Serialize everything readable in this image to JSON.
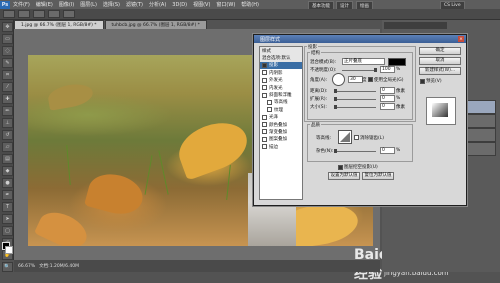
{
  "menubar": {
    "items": [
      "文件(F)",
      "编辑(E)",
      "图像(I)",
      "图层(L)",
      "选择(S)",
      "滤镜(T)",
      "分析(A)",
      "3D(D)",
      "视图(V)",
      "窗口(W)",
      "帮助(H)"
    ],
    "workspace_buttons": [
      "基本功能",
      "设计",
      "绘画",
      "CS Live"
    ]
  },
  "doc_tabs": [
    "1.jpg @ 66.7% (图层 1, RGB/8#) *",
    "tuhbcb.jpg @ 66.7% (图层 1, RGB/8#) *"
  ],
  "statusbar": {
    "zoom": "66.67%",
    "doc_info": "文档:1.20M/6.40M"
  },
  "dialog": {
    "title": "图层样式",
    "styles": [
      {
        "label": "样式",
        "type": "header"
      },
      {
        "label": "混合选项:默认",
        "type": "header"
      },
      {
        "label": "投影",
        "checked": true,
        "selected": true
      },
      {
        "label": "内阴影",
        "checked": false
      },
      {
        "label": "外发光",
        "checked": false
      },
      {
        "label": "内发光",
        "checked": false
      },
      {
        "label": "斜面和浮雕",
        "checked": false
      },
      {
        "label": "等高线",
        "checked": false,
        "sub": true
      },
      {
        "label": "纹理",
        "checked": false,
        "sub": true
      },
      {
        "label": "光泽",
        "checked": false
      },
      {
        "label": "颜色叠加",
        "checked": false
      },
      {
        "label": "渐变叠加",
        "checked": false
      },
      {
        "label": "图案叠加",
        "checked": false
      },
      {
        "label": "描边",
        "checked": false
      }
    ],
    "section_title": "投影",
    "structure_title": "结构",
    "blend_mode_label": "混合模式(B):",
    "blend_mode_value": "正片叠底",
    "opacity_label": "不透明度(O):",
    "opacity_value": "100",
    "opacity_unit": "%",
    "angle_label": "角度(A):",
    "angle_value": "30",
    "angle_unit": "度",
    "global_light_label": "使用全局光(G)",
    "distance_label": "距离(D):",
    "distance_value": "0",
    "distance_unit": "像素",
    "spread_label": "扩展(R):",
    "spread_value": "0",
    "spread_unit": "%",
    "size_label": "大小(S):",
    "size_value": "0",
    "size_unit": "像素",
    "quality_title": "品质",
    "contour_label": "等高线:",
    "antialias_label": "消除锯齿(L)",
    "noise_label": "杂色(N):",
    "noise_value": "0",
    "noise_unit": "%",
    "knockout_label": "图层挖空投影(U)",
    "default_btn": "设置为默认值",
    "reset_btn": "复位为默认值",
    "ok_btn": "确定",
    "cancel_btn": "取消",
    "new_style_btn": "新建样式(W)...",
    "preview_label": "预览(V)"
  },
  "watermark": {
    "text": "Baidu 经验",
    "sub": "jingyan.baidu.com"
  }
}
